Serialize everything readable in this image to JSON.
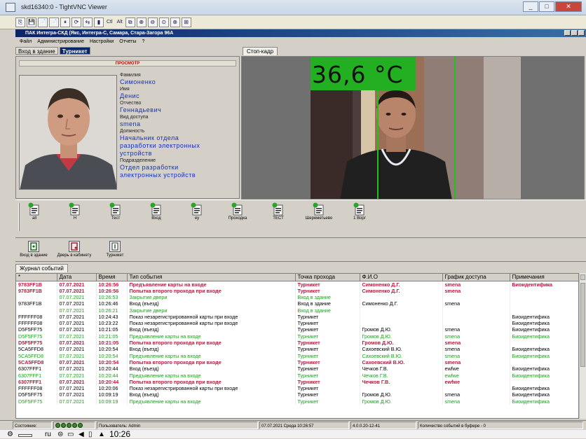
{
  "window": {
    "title": "skd16340:0 - TightVNC Viewer",
    "buttons": [
      "_",
      "□",
      "✕"
    ]
  },
  "vnc_toolbar": [
    "⎘",
    "💾",
    "📄",
    "📄",
    "⏸",
    "⟳",
    "⇆",
    "▮",
    "Ctl",
    "Alt",
    "⧉",
    "⊕",
    "⊖",
    "⊙",
    "⊗",
    "⊞"
  ],
  "app": {
    "title": "ПАК Интегра-СКД (Якс, Интегра-С, Самара, Стара-Загора 96А",
    "menu": [
      "Файл",
      "Администрирование",
      "Настройки",
      "Отчеты",
      "?"
    ],
    "tabs": [
      "Вход в здание",
      "Турникет"
    ],
    "camera_tab": "Стоп-кадр",
    "banner": "ПРОСМОТР"
  },
  "person": {
    "surname_label": "Фамилия",
    "surname": "Симоненко",
    "name_label": "Имя",
    "name": "Денис",
    "patronymic_label": "Отчество",
    "patronymic": "Геннадьевич",
    "access_label": "Вид доступа",
    "access": "smena",
    "position_label": "Должность",
    "position_1": "Начальник отдела",
    "position_2": "разработки электронных",
    "position_3": "устройств",
    "department_label": "Подразделение",
    "department_1": "Отдел разработки",
    "department_2": "электронных устройств"
  },
  "camera": {
    "temperature": "36,6 °C",
    "temp_color": "#22b022"
  },
  "doc_icons": [
    "all",
    "Н",
    "Тест",
    "Вход",
    "ey",
    "Проходка",
    "ТЕСТ",
    "Шереметьево",
    "1 Ворг"
  ],
  "actions": [
    "Вход в здание",
    "Дверь в кабинету",
    "Турникет"
  ],
  "journal": {
    "tab": "Журнал событий",
    "columns": [
      "*",
      "Дата",
      "Время",
      "Тип события",
      "Точка прохода",
      "Ф.И.О",
      "График доступа",
      "Примечания"
    ],
    "rows": [
      {
        "c": "red",
        "v": [
          "9783FF1B",
          "07.07.2021",
          "10:26:56",
          "Предъявление карты на входе",
          "Турникет",
          "Симоненко Д.Г.",
          "smena",
          "Биоидентифика"
        ]
      },
      {
        "c": "red",
        "v": [
          "9783FF1B",
          "07.07.2021",
          "10:26:56",
          "Попытка второго прохода при входе",
          "Турникет",
          "Симоненко Д.Г.",
          "smena",
          ""
        ]
      },
      {
        "c": "green",
        "v": [
          "",
          "07.07.2021",
          "10:26:53",
          "Закрытие двери",
          "Вход в здание",
          "",
          "",
          ""
        ]
      },
      {
        "c": "black",
        "v": [
          "9783FF1B",
          "07.07.2021",
          "10:26:46",
          "Вход (въезд)",
          "Вход в здание",
          "Симоненко Д.Г.",
          "smena",
          ""
        ]
      },
      {
        "c": "green",
        "v": [
          "",
          "07.07.2021",
          "10:26:21",
          "Закрытие двери",
          "Вход в здание",
          "",
          "",
          ""
        ]
      },
      {
        "c": "black",
        "v": [
          "FFFFFF08",
          "07.07.2021",
          "10:24:43",
          "Показ незарегистрированной карты при входе",
          "Турникет",
          "",
          "",
          "Биоидентифика"
        ]
      },
      {
        "c": "black",
        "v": [
          "FFFFFF08",
          "07.07.2021",
          "10:23:22",
          "Показ незарегистрированной карты при входе",
          "Турникет",
          "",
          "",
          "Биоидентифика"
        ]
      },
      {
        "c": "black",
        "v": [
          "D5F5FF75",
          "07.07.2021",
          "10:21:05",
          "Вход (въезд)",
          "Турникет",
          "Громов Д.Ю.",
          "smena",
          "Биоидентифика"
        ]
      },
      {
        "c": "green",
        "v": [
          "D5F5FF75",
          "07.07.2021",
          "10:21:05",
          "Предъявление карты на входе",
          "Турникет",
          "Громов Д.Ю.",
          "smena",
          "Биоидентифика"
        ]
      },
      {
        "c": "red",
        "v": [
          "D5F5FF75",
          "07.07.2021",
          "10:21:05",
          "Попытка второго прохода при входе",
          "Турникет",
          "Громов Д.Ю.",
          "smena",
          ""
        ]
      },
      {
        "c": "black",
        "v": [
          "5CA5FFD8",
          "07.07.2021",
          "10:20:54",
          "Вход (въезд)",
          "Турникет",
          "Сахоевский В.Ю.",
          "smena",
          "Биоидентифика"
        ]
      },
      {
        "c": "green",
        "v": [
          "5CA5FFD8",
          "07.07.2021",
          "10:20:54",
          "Предъявление карты на входе",
          "Турникет",
          "Сахоевский В.Ю.",
          "smena",
          "Биоидентифика"
        ]
      },
      {
        "c": "red",
        "v": [
          "5CA5FFD8",
          "07.07.2021",
          "10:20:54",
          "Попытка второго прохода при входе",
          "Турникет",
          "Сахоевский В.Ю.",
          "smena",
          ""
        ]
      },
      {
        "c": "black",
        "v": [
          "6307FFF1",
          "07.07.2021",
          "10:20:44",
          "Вход (въезд)",
          "Турникет",
          "Чечков Г.В.",
          "ewfwe",
          "Биоидентифика"
        ]
      },
      {
        "c": "green",
        "v": [
          "6307FFF1",
          "07.07.2021",
          "10:20:44",
          "Предъявление карты на входе",
          "Турникет",
          "Чечков Г.В.",
          "ewfwe",
          "Биоидентифика"
        ]
      },
      {
        "c": "red",
        "v": [
          "6307FFF1",
          "07.07.2021",
          "10:20:44",
          "Попытка второго прохода при входе",
          "Турникет",
          "Чечков Г.В.",
          "ewfwe",
          ""
        ]
      },
      {
        "c": "black",
        "v": [
          "FFFFFF08",
          "07.07.2021",
          "10:20:06",
          "Показ незарегистрированной карты при входе",
          "Турникет",
          "",
          "",
          "Биоидентифика"
        ]
      },
      {
        "c": "black",
        "v": [
          "D5F5FF75",
          "07.07.2021",
          "10:09:19",
          "Вход (въезд)",
          "Турникет",
          "Громов Д.Ю.",
          "smena",
          "Биоидентифика"
        ]
      },
      {
        "c": "green",
        "v": [
          "D5F5FF75",
          "07.07.2021",
          "10:09:19",
          "Предъявление карты на входе",
          "Турникет",
          "Громов Д.Ю.",
          "smena",
          "Биоидентифика"
        ]
      }
    ]
  },
  "status": {
    "state_label": "Состояние:",
    "user": "Пользователь: Admin",
    "datetime": "07.07.2021 Среда 10:26:57",
    "version": "4.0.0.20-12-41",
    "buffer": "Количество событий в буфере - 0"
  },
  "taskbar": {
    "lang": "ru",
    "time": "10:26"
  }
}
